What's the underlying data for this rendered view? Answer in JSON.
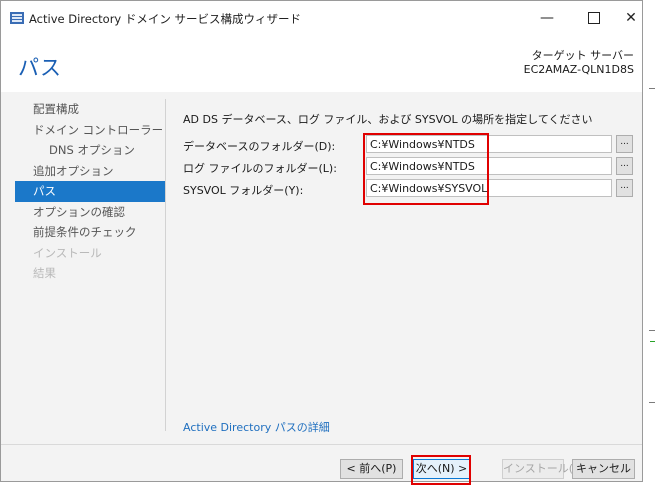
{
  "window": {
    "title": "Active Directory ドメイン サービス構成ウィザード",
    "minimize_glyph": "—",
    "close_glyph": "✕"
  },
  "header": {
    "page_title": "パス",
    "target_label": "ターゲット サーバー",
    "target_server": "EC2AMAZ-QLN1D8S"
  },
  "sidebar": {
    "items": [
      {
        "label": "配置構成",
        "state": "normal"
      },
      {
        "label": "ドメイン コントローラー オプシ...",
        "state": "normal"
      },
      {
        "label": "DNS オプション",
        "state": "normal"
      },
      {
        "label": "追加オプション",
        "state": "normal"
      },
      {
        "label": "パス",
        "state": "active"
      },
      {
        "label": "オプションの確認",
        "state": "normal"
      },
      {
        "label": "前提条件のチェック",
        "state": "normal"
      },
      {
        "label": "インストール",
        "state": "disabled"
      },
      {
        "label": "結果",
        "state": "disabled"
      }
    ]
  },
  "main": {
    "instruction": "AD DS データベース、ログ ファイル、および SYSVOL の場所を指定してください",
    "fields": [
      {
        "label": "データベースのフォルダー(D):",
        "value": "C:¥Windows¥NTDS"
      },
      {
        "label": "ログ ファイルのフォルダー(L):",
        "value": "C:¥Windows¥NTDS"
      },
      {
        "label": "SYSVOL フォルダー(Y):",
        "value": "C:¥Windows¥SYSVOL"
      }
    ],
    "browse_label": "...",
    "help_link": "Active Directory パスの詳細"
  },
  "footer": {
    "prev": "< 前へ(P)",
    "next": "次へ(N) >",
    "install": "インストール(I)",
    "cancel": "キャンセル"
  },
  "colors": {
    "accent": "#1b78c9",
    "title": "#1a5fb4",
    "link": "#1f6fbf",
    "highlight_box": "#e00000"
  }
}
